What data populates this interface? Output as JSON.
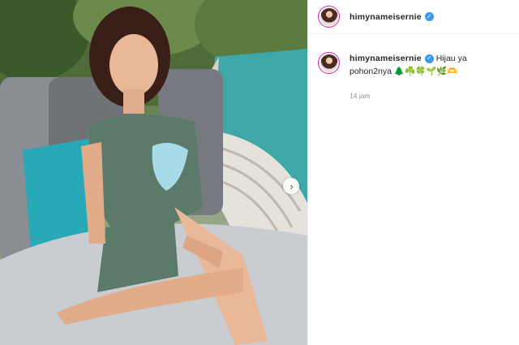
{
  "post": {
    "username": "himynameisernie",
    "verified_icon": "verified-badge-icon",
    "caption_first_line": "Hijau ya",
    "caption_second_line": "pohon2nya 🌲☘️🍀🌱🌿🫶",
    "timestamp": "14 jam"
  },
  "media": {
    "next_icon": "chevron-right-icon",
    "next_glyph": "›"
  },
  "colors": {
    "accent_blue": "#3897f0",
    "pool_water": "#3fa7a8",
    "cushion_teal": "#27a9b8",
    "sofa_grey": "#c9ccd0"
  }
}
